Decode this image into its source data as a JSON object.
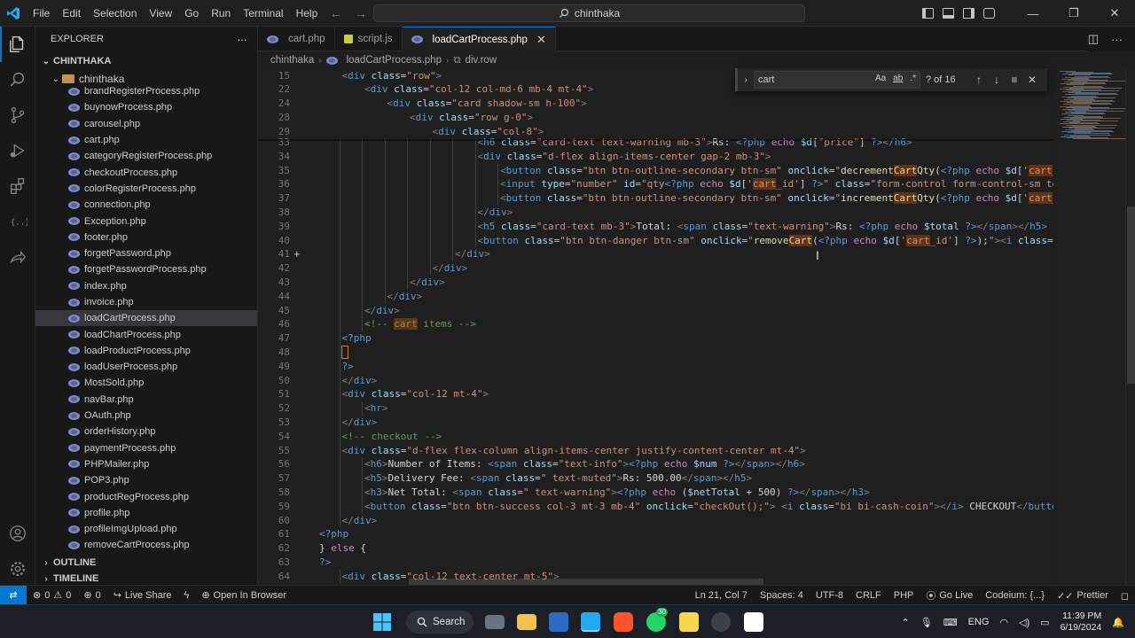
{
  "menu": [
    "File",
    "Edit",
    "Selection",
    "View",
    "Go",
    "Run",
    "Terminal",
    "Help"
  ],
  "command_center": "chinthaka",
  "sidebar": {
    "title": "EXPLORER",
    "more": "···",
    "root": "CHINTHAKA",
    "folder": "chinthaka",
    "files": [
      "brandRegisterProcess.php",
      "buynowProcess.php",
      "carousel.php",
      "cart.php",
      "categoryRegisterProcess.php",
      "checkoutProcess.php",
      "colorRegisterProcess.php",
      "connection.php",
      "Exception.php",
      "footer.php",
      "forgetPassword.php",
      "forgetPasswordProcess.php",
      "index.php",
      "invoice.php",
      "loadCartProcess.php",
      "loadChartProcess.php",
      "loadProductProcess.php",
      "loadUserProcess.php",
      "MostSold.php",
      "navBar.php",
      "OAuth.php",
      "orderHistory.php",
      "paymentProcess.php",
      "PHPMailer.php",
      "POP3.php",
      "productRegProcess.php",
      "profile.php",
      "profileImgUpload.php",
      "removeCartProcess.php"
    ],
    "active_file": "loadCartProcess.php",
    "outline": "OUTLINE",
    "timeline": "TIMELINE"
  },
  "tabs": [
    {
      "label": "cart.php",
      "icon": "php-icon"
    },
    {
      "label": "script.js",
      "icon": "js-icon"
    },
    {
      "label": "loadCartProcess.php",
      "icon": "php-icon",
      "active": true
    }
  ],
  "breadcrumb": [
    "chinthaka",
    "loadCartProcess.php",
    "div.row"
  ],
  "find": {
    "query": "cart",
    "opt_case": "Aa",
    "opt_word": "ab",
    "opt_regex": ".*",
    "count": "? of 16"
  },
  "sticky": [
    {
      "n": "15",
      "indent": 1,
      "html": "<span class='br'>&lt;</span><span class='tg'>div</span> <span class='at'>class</span>=<span class='st'>\"row\"</span><span class='br'>&gt;</span>"
    },
    {
      "n": "22",
      "indent": 2,
      "html": "<span class='br'>&lt;</span><span class='tg'>div</span> <span class='at'>class</span>=<span class='st'>\"col-12 col-md-6 mb-4 mt-4\"</span><span class='br'>&gt;</span>"
    },
    {
      "n": "24",
      "indent": 3,
      "html": "<span class='br'>&lt;</span><span class='tg'>div</span> <span class='at'>class</span>=<span class='st'>\"card shadow-sm h-100\"</span><span class='br'>&gt;</span>"
    },
    {
      "n": "28",
      "indent": 4,
      "html": "<span class='br'>&lt;</span><span class='tg'>div</span> <span class='at'>class</span>=<span class='st'>\"row g-0\"</span><span class='br'>&gt;</span>"
    },
    {
      "n": "29",
      "indent": 5,
      "html": "<span class='br'>&lt;</span><span class='tg'>div</span> <span class='at'>class</span>=<span class='st'>\"col-8\"</span><span class='br'>&gt;</span>"
    }
  ],
  "code": [
    {
      "n": "33",
      "indent": 7,
      "html": "<span class='br'>&lt;</span><span class='tg'>h6</span> <span class='at'>class</span>=<span class='st'>\"card-text text-warning mb-3\"</span><span class='br'>&gt;</span><span class='tx'>Rs: </span><span class='ph'>&lt;?php</span> <span class='kw'>echo</span> <span class='vr'>$d</span>[<span class='st'>\"price\"</span>] <span class='ph'>?&gt;</span><span class='br'>&lt;/</span><span class='tg'>h6</span><span class='br'>&gt;</span>"
    },
    {
      "n": "34",
      "indent": 7,
      "html": "<span class='br'>&lt;</span><span class='tg'>div</span> <span class='at'>class</span>=<span class='st'>\"d-flex align-items-center gap-2 mb-3\"</span><span class='br'>&gt;</span>"
    },
    {
      "n": "35",
      "indent": 8,
      "html": "<span class='br'>&lt;</span><span class='tg'>button</span> <span class='at'>class</span>=<span class='st'>\"btn btn-outline-secondary btn-sm\"</span> <span class='at'>onclick</span>=<span class='st'>\"</span><span class='fn'>decrement<span class='hl'>Cart</span>Qty</span>(<span class='ph'>&lt;?php</span> <span class='kw'>echo</span> <span class='vr'>$d</span>[<span class='st'>'<span class='hl'>cart</span>_id'</span>"
    },
    {
      "n": "36",
      "indent": 8,
      "html": "<span class='br'>&lt;</span><span class='tg'>input</span> <span class='at'>type</span>=<span class='st'>\"number\"</span> <span class='at'>id</span>=<span class='st'>\"qty</span><span class='ph'>&lt;?php</span> <span class='kw'>echo</span> <span class='vr'>$d</span>[<span class='st'>'<span class='hl'>cart</span>_id'</span>] <span class='ph'>?&gt;</span><span class='st'>\"</span> <span class='at'>class</span>=<span class='st'>\"form-control form-control-sm text</span>"
    },
    {
      "n": "37",
      "indent": 8,
      "html": "<span class='br'>&lt;</span><span class='tg'>button</span> <span class='at'>class</span>=<span class='st'>\"btn btn-outline-secondary btn-sm\"</span> <span class='at'>onclick</span>=<span class='st'>\"</span><span class='fn'>increment<span class='hl'>Cart</span>Qty</span>(<span class='ph'>&lt;?php</span> <span class='kw'>echo</span> <span class='vr'>$d</span>[<span class='st'>'<span class='hl'>cart</span>_id'</span>"
    },
    {
      "n": "38",
      "indent": 7,
      "html": "<span class='br'>&lt;/</span><span class='tg'>div</span><span class='br'>&gt;</span>"
    },
    {
      "n": "39",
      "indent": 7,
      "html": "<span class='br'>&lt;</span><span class='tg'>h5</span> <span class='at'>class</span>=<span class='st'>\"card-text mb-3\"</span><span class='br'>&gt;</span><span class='tx'>Total: </span><span class='br'>&lt;</span><span class='tg'>span</span> <span class='at'>class</span>=<span class='st'>\"text-warning\"</span><span class='br'>&gt;</span><span class='tx'>Rs: </span><span class='ph'>&lt;?php</span> <span class='kw'>echo</span> <span class='vr'>$total</span> <span class='ph'>?&gt;</span><span class='br'>&lt;/</span><span class='tg'>span</span><span class='br'>&gt;&lt;/</span><span class='tg'>h5</span><span class='br'>&gt;</span>"
    },
    {
      "n": "40",
      "indent": 7,
      "html": "<span class='br'>&lt;</span><span class='tg'>button</span> <span class='at'>class</span>=<span class='st'>\"btn btn-danger btn-sm\"</span> <span class='at'>onclick</span>=<span class='st'>\"</span><span class='fn'>remove<span class='hl'>Cart</span></span>(<span class='ph'>&lt;?php</span> <span class='kw'>echo</span> <span class='vr'>$d</span>[<span class='st'>'<span class='hl'>cart</span>_id'</span>] <span class='ph'>?&gt;</span>);<span class='st'>\"</span><span class='br'>&gt;&lt;</span><span class='tg'>i</span> <span class='at'>class</span>=<span class='st'>\"bi</span>"
    },
    {
      "n": "41",
      "indent": 6,
      "html": "<span class='br'>&lt;/</span><span class='tg'>div</span><span class='br'>&gt;</span>"
    },
    {
      "n": "42",
      "indent": 5,
      "html": "<span class='br'>&lt;/</span><span class='tg'>div</span><span class='br'>&gt;</span>"
    },
    {
      "n": "43",
      "indent": 4,
      "html": "<span class='br'>&lt;/</span><span class='tg'>div</span><span class='br'>&gt;</span>"
    },
    {
      "n": "44",
      "indent": 3,
      "html": "<span class='br'>&lt;/</span><span class='tg'>div</span><span class='br'>&gt;</span>"
    },
    {
      "n": "45",
      "indent": 2,
      "html": "<span class='br'>&lt;/</span><span class='tg'>div</span><span class='br'>&gt;</span>"
    },
    {
      "n": "46",
      "indent": 2,
      "html": "<span class='cm'>&lt;!-- <span class='hl'>cart</span> items --&gt;</span>"
    },
    {
      "n": "47",
      "indent": 1,
      "html": "<span class='ph'>&lt;?php</span>"
    },
    {
      "n": "48",
      "indent": 1,
      "html": "<span class='hlb'> </span>"
    },
    {
      "n": "49",
      "indent": 1,
      "html": "<span class='ph'>?&gt;</span>"
    },
    {
      "n": "50",
      "indent": 1,
      "html": "<span class='br'>&lt;/</span><span class='tg'>div</span><span class='br'>&gt;</span>"
    },
    {
      "n": "51",
      "indent": 1,
      "html": "<span class='br'>&lt;</span><span class='tg'>div</span> <span class='at'>class</span>=<span class='st'>\"col-12 mt-4\"</span><span class='br'>&gt;</span>"
    },
    {
      "n": "52",
      "indent": 2,
      "html": "<span class='br'>&lt;</span><span class='tg'>hr</span><span class='br'>&gt;</span>"
    },
    {
      "n": "53",
      "indent": 1,
      "html": "<span class='br'>&lt;/</span><span class='tg'>div</span><span class='br'>&gt;</span>"
    },
    {
      "n": "54",
      "indent": 1,
      "html": "<span class='cm'>&lt;!-- checkout --&gt;</span>"
    },
    {
      "n": "55",
      "indent": 1,
      "html": "<span class='br'>&lt;</span><span class='tg'>div</span> <span class='at'>class</span>=<span class='st'>\"d-flex flex-column align-items-center justify-content-center mt-4\"</span><span class='br'>&gt;</span>"
    },
    {
      "n": "56",
      "indent": 2,
      "html": "<span class='br'>&lt;</span><span class='tg'>h6</span><span class='br'>&gt;</span><span class='tx'>Number of Items: </span><span class='br'>&lt;</span><span class='tg'>span</span> <span class='at'>class</span>=<span class='st'>\"text-info\"</span><span class='br'>&gt;</span><span class='ph'>&lt;?php</span> <span class='kw'>echo</span> <span class='vr'>$num</span> <span class='ph'>?&gt;</span><span class='br'>&lt;/</span><span class='tg'>span</span><span class='br'>&gt;&lt;/</span><span class='tg'>h6</span><span class='br'>&gt;</span>"
    },
    {
      "n": "57",
      "indent": 2,
      "html": "<span class='br'>&lt;</span><span class='tg'>h5</span><span class='br'>&gt;</span><span class='tx'>Delivery Fee: </span><span class='br'>&lt;</span><span class='tg'>span</span> <span class='at'>class</span>=<span class='st'>\" text-muted\"</span><span class='br'>&gt;</span><span class='tx'>Rs: 500.00</span><span class='br'>&lt;/</span><span class='tg'>span</span><span class='br'>&gt;&lt;/</span><span class='tg'>h5</span><span class='br'>&gt;</span>"
    },
    {
      "n": "58",
      "indent": 2,
      "html": "<span class='br'>&lt;</span><span class='tg'>h3</span><span class='br'>&gt;</span><span class='tx'>Net Total: </span><span class='br'>&lt;</span><span class='tg'>span</span> <span class='at'>class</span>=<span class='st'>\" text-warning\"</span><span class='br'>&gt;</span><span class='ph'>&lt;?php</span> <span class='kw'>echo</span> (<span class='vr'>$netTotal</span> + <span class='tx'>500</span>) <span class='ph'>?&gt;</span><span class='br'>&lt;/</span><span class='tg'>span</span><span class='br'>&gt;&lt;/</span><span class='tg'>h3</span><span class='br'>&gt;</span>"
    },
    {
      "n": "59",
      "indent": 2,
      "html": "<span class='br'>&lt;</span><span class='tg'>button</span> <span class='at'>class</span>=<span class='st'>\"btn btn-success col-3 mt-3 mb-4\"</span> <span class='at'>onclick</span>=<span class='st'>\"checkOut();\"</span><span class='br'>&gt;</span> <span class='br'>&lt;</span><span class='tg'>i</span> <span class='at'>class</span>=<span class='st'>\"bi bi-cash-coin\"</span><span class='br'>&gt;&lt;/</span><span class='tg'>i</span><span class='br'>&gt;</span><span class='tx'> CHECKOUT</span><span class='br'>&lt;/</span><span class='tg'>button</span><span class='br'>&gt;</span>"
    },
    {
      "n": "60",
      "indent": 1,
      "html": "<span class='br'>&lt;/</span><span class='tg'>div</span><span class='br'>&gt;</span>"
    },
    {
      "n": "61",
      "indent": 0,
      "html": "<span class='ph'>&lt;?php</span>"
    },
    {
      "n": "62",
      "indent": 0,
      "html": "<span class='tx'>} </span><span class='kw'>else</span><span class='tx'> {</span>"
    },
    {
      "n": "63",
      "indent": 0,
      "html": "<span class='ph'>?&gt;</span>"
    },
    {
      "n": "64",
      "indent": 1,
      "html": "<span class='br'>&lt;</span><span class='tg'>div</span> <span class='at'>class</span>=<span class='st'>\"col-12 text-center mt-5\"</span><span class='br'>&gt;</span>"
    }
  ],
  "status": {
    "errors": "0",
    "warnings": "0",
    "info": "0",
    "live_share": "Live Share",
    "open_browser": "Open In Browser",
    "position": "Ln 21, Col 7",
    "spaces": "Spaces: 4",
    "encoding": "UTF-8",
    "eol": "CRLF",
    "language": "PHP",
    "go_live": "Go Live",
    "codeium": "Codeium: {...}",
    "prettier": "Prettier"
  },
  "taskbar": {
    "search": "Search",
    "lang": "ENG",
    "time": "11:39 PM",
    "date": "6/19/2024",
    "badge": "30"
  }
}
